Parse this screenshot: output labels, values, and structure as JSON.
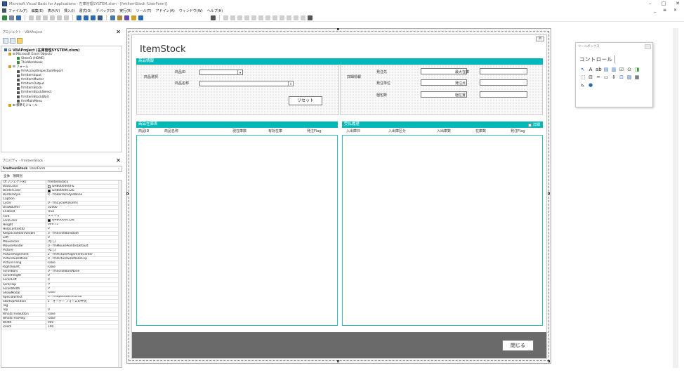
{
  "window": {
    "title": "Microsoft Visual Basic for Applications - 在庫管理SYSTEM.xlsm - [frmItemStock (UserForm)]",
    "controls": [
      "–",
      "□",
      "✕"
    ]
  },
  "menu": {
    "items": [
      "ファイル(F)",
      "編集(E)",
      "表示(V)",
      "挿入(I)",
      "書式(O)",
      "デバッグ(D)",
      "実行(R)",
      "ツール(T)",
      "アドイン(A)",
      "ウィンドウ(W)",
      "ヘルプ(H)"
    ],
    "mdi_controls": "_ ≡ ×"
  },
  "project": {
    "title": "プロジェクト - VBAProject",
    "close": "✕",
    "tree": [
      {
        "text": "⊟ VBAProject (在庫管理SYSTEM.xlsm)",
        "indent": 0,
        "bold": true,
        "icon": "#2b6cb0"
      },
      {
        "text": "⊟ Microsoft Excel Objects",
        "indent": 1,
        "bold": false,
        "icon": "#d4a017"
      },
      {
        "text": "Sheet1 (HOME)",
        "indent": 3,
        "bold": false,
        "icon": "#3a8f3a"
      },
      {
        "text": "ThisWorkbook",
        "indent": 3,
        "bold": false,
        "icon": "#3a8f3a"
      },
      {
        "text": "⊟ フォーム",
        "indent": 1,
        "bold": false,
        "icon": "#d4a017"
      },
      {
        "text": "frmAcceptInspectionReport",
        "indent": 3,
        "bold": false,
        "icon": "#555"
      },
      {
        "text": "frmItemInput",
        "indent": 3,
        "bold": false,
        "icon": "#555"
      },
      {
        "text": "frmItemMaster",
        "indent": 3,
        "bold": false,
        "icon": "#555"
      },
      {
        "text": "frmItemOutput",
        "indent": 3,
        "bold": false,
        "icon": "#555"
      },
      {
        "text": "frmItemStock",
        "indent": 3,
        "bold": false,
        "icon": "#555"
      },
      {
        "text": "frmItemStockSelect",
        "indent": 3,
        "bold": false,
        "icon": "#555"
      },
      {
        "text": "frmItemStockWait",
        "indent": 3,
        "bold": false,
        "icon": "#555"
      },
      {
        "text": "frmMainMenu",
        "indent": 3,
        "bold": false,
        "icon": "#555"
      },
      {
        "text": "⊞ 標準モジュール",
        "indent": 1,
        "bold": false,
        "icon": "#d4a017"
      }
    ]
  },
  "properties": {
    "title": "プロパティ - frmItemStock",
    "close": "✕",
    "object_name": "frmItemStock",
    "object_type": "UserForm",
    "tabs": [
      "全体",
      "項目別"
    ],
    "rows": [
      {
        "name": "(オブジェクト名)",
        "value": "frmItemStock"
      },
      {
        "name": "BackColor",
        "value": "&H8000000F&",
        "swatch": "#f0f0f0"
      },
      {
        "name": "BorderColor",
        "value": "&H80000012&",
        "swatch": "#000000"
      },
      {
        "name": "BorderStyle",
        "value": "0 - fmBorderStyleNone"
      },
      {
        "name": "Caption",
        "value": ""
      },
      {
        "name": "Cycle",
        "value": "0 - fmCycleAllForms"
      },
      {
        "name": "DrawBuffer",
        "value": "32000"
      },
      {
        "name": "Enabled",
        "value": "True"
      },
      {
        "name": "Font",
        "value": "メイリオ"
      },
      {
        "name": "ForeColor",
        "value": "&H80000012&",
        "swatch": "#000000"
      },
      {
        "name": "Height",
        "value": "699.75"
      },
      {
        "name": "HelpContextID",
        "value": "0"
      },
      {
        "name": "KeepScrollBarsVisible",
        "value": "3 - fmScrollBarsBoth"
      },
      {
        "name": "Left",
        "value": "0"
      },
      {
        "name": "MouseIcon",
        "value": "(なし)"
      },
      {
        "name": "MousePointer",
        "value": "0 - fmMousePointerDefault"
      },
      {
        "name": "Picture",
        "value": "(なし)"
      },
      {
        "name": "PictureAlignment",
        "value": "2 - fmPictureAlignmentCenter"
      },
      {
        "name": "PictureSizeMode",
        "value": "0 - fmPictureSizeModeClip"
      },
      {
        "name": "PictureTiling",
        "value": "False"
      },
      {
        "name": "RightToLeft",
        "value": "False"
      },
      {
        "name": "ScrollBars",
        "value": "0 - fmScrollBarsNone"
      },
      {
        "name": "ScrollHeight",
        "value": "0"
      },
      {
        "name": "ScrollLeft",
        "value": "0"
      },
      {
        "name": "ScrollTop",
        "value": "0"
      },
      {
        "name": "ScrollWidth",
        "value": "0"
      },
      {
        "name": "ShowModal",
        "value": "False"
      },
      {
        "name": "SpecialEffect",
        "value": "0 - fmSpecialEffectFlat"
      },
      {
        "name": "StartUpPosition",
        "value": "1 - オーナー フォームの中央"
      },
      {
        "name": "Tag",
        "value": ""
      },
      {
        "name": "Top",
        "value": "0"
      },
      {
        "name": "WhatsThisButton",
        "value": "False"
      },
      {
        "name": "WhatsThisHelp",
        "value": "False"
      },
      {
        "name": "Width",
        "value": "900"
      },
      {
        "name": "Zoom",
        "value": "100"
      }
    ]
  },
  "form": {
    "close": "☒",
    "title": "ItemStock",
    "item_info": {
      "header": "商品情報",
      "select_label": "商品選択",
      "id_label": "商品ID",
      "name_label": "商品名称",
      "reset": "リセット",
      "detail_label": "詳細情報",
      "supplier": "発注先",
      "order_unit": "発注単位",
      "count": "梱包数",
      "max_stock": "最大在庫",
      "order_point": "発注点",
      "location": "梱位置"
    },
    "stock": {
      "header": "商品在庫表",
      "columns": [
        "商品ID",
        "商品名称",
        "現在庫数",
        "有効在庫",
        "発注Flag"
      ]
    },
    "history": {
      "header": "受払履歴",
      "detail_check": "詳細",
      "columns": [
        "入出庫日",
        "入出庫区分",
        "入出庫数",
        "在庫数",
        "発注Flag"
      ]
    },
    "close_button": "閉じる"
  },
  "toolbox": {
    "title": "ツールボックス",
    "tab": "コントロール",
    "tools": [
      {
        "glyph": "↖",
        "color": "#1f5fbf"
      },
      {
        "glyph": "A",
        "color": "#222"
      },
      {
        "glyph": "ab",
        "color": "#222"
      },
      {
        "glyph": "▤",
        "color": "#2b6cb0"
      },
      {
        "glyph": "▥",
        "color": "#2b6cb0"
      },
      {
        "glyph": "☑",
        "color": "#333"
      },
      {
        "glyph": "⊙",
        "color": "#333"
      },
      {
        "glyph": "◨",
        "color": "#2a9a2a"
      },
      {
        "glyph": "⬚",
        "color": "#333"
      },
      {
        "glyph": "⊟",
        "color": "#333"
      },
      {
        "glyph": "━",
        "color": "#333"
      },
      {
        "glyph": "▭",
        "color": "#333"
      },
      {
        "glyph": "⇕",
        "color": "#333"
      },
      {
        "glyph": "⊡",
        "color": "#2b6cb0"
      },
      {
        "glyph": "▧",
        "color": "#2b6cb0"
      },
      {
        "glyph": "▦",
        "color": "#333"
      },
      {
        "glyph": "⊾",
        "color": "#333"
      },
      {
        "glyph": "●",
        "color": "#2b6cb0"
      }
    ]
  }
}
